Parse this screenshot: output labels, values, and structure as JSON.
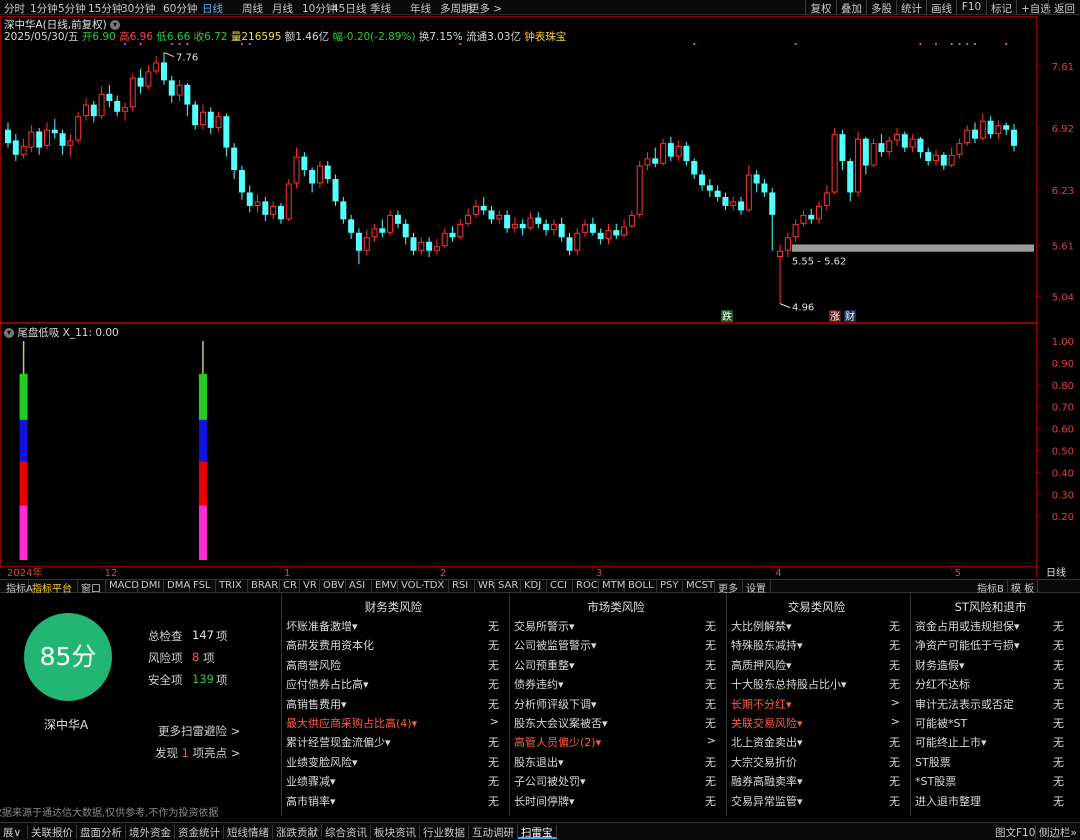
{
  "periods": [
    "分时",
    "1分钟",
    "5分钟",
    "15分钟",
    "30分钟",
    "60分钟",
    "日线",
    "周线",
    "月线",
    "10分钟",
    "45日线",
    "季线",
    "年线",
    "多周期",
    "更多 >"
  ],
  "active_period": "日线",
  "toolbar_right": [
    "复权",
    "叠加",
    "多股",
    "统计",
    "画线",
    "F10",
    "标记",
    "+自选",
    "返回"
  ],
  "stock": {
    "title": "深中华A(日线,前复权)",
    "date": "2025/05/30/五",
    "open": "开6.90",
    "high": "高6.96",
    "low": "低6.66",
    "close": "收6.72",
    "volume": "量216595",
    "amount": "额1.46亿",
    "change": "幅-0.20(-2.89%)",
    "turnover": "换7.15%",
    "float": "流通3.03亿",
    "tag": "钟表珠宝"
  },
  "chart_data": {
    "type": "candlestick",
    "price_ylim": [
      4.8,
      7.9
    ],
    "price_ticks": [
      "7.61",
      "6.92",
      "6.23",
      "5.61",
      "5.04"
    ],
    "price_tick_values": [
      7.61,
      6.92,
      6.23,
      5.61,
      5.04
    ],
    "annotations": {
      "high": "7.76",
      "low": "4.96",
      "range": "5.55 - 5.62"
    },
    "markers": {
      "down": "跌",
      "up": "涨",
      "fin": "财"
    },
    "x_labels": [
      "2024年",
      "12",
      "1",
      "2",
      "3",
      "4",
      "5"
    ],
    "x_label_index": [
      0,
      12,
      35,
      55,
      75,
      98,
      121
    ],
    "indicator_title": "尾盘低吸 X_11: 0.00",
    "indicator_ticks": [
      "1.00",
      "0.90",
      "0.80",
      "0.70",
      "0.60",
      "0.50",
      "0.40",
      "0.30",
      "0.20"
    ],
    "indicator_tick_values": [
      1.0,
      0.9,
      0.8,
      0.7,
      0.6,
      0.5,
      0.4,
      0.3,
      0.2
    ],
    "indicator_bars": [
      {
        "index": 2,
        "value": 1.0,
        "segments": [
          {
            "to": 0.25,
            "color": "#ff2bd6"
          },
          {
            "to": 0.45,
            "color": "#e80000"
          },
          {
            "to": 0.64,
            "color": "#1111e0"
          },
          {
            "to": 0.85,
            "color": "#22cc22"
          },
          {
            "to": 1.0,
            "color": "#c8c878"
          }
        ]
      },
      {
        "index": 25,
        "value": 1.0,
        "segments": [
          {
            "to": 0.25,
            "color": "#ff2bd6"
          },
          {
            "to": 0.45,
            "color": "#e80000"
          },
          {
            "to": 0.64,
            "color": "#1111e0"
          },
          {
            "to": 0.85,
            "color": "#22cc22"
          },
          {
            "to": 1.0,
            "color": "#c8c878"
          }
        ]
      }
    ],
    "candles": [
      [
        6.9,
        6.75,
        6.98,
        6.7
      ],
      [
        6.78,
        6.62,
        6.85,
        6.55
      ],
      [
        6.62,
        6.72,
        6.8,
        6.58
      ],
      [
        6.7,
        6.88,
        6.95,
        6.65
      ],
      [
        6.88,
        6.7,
        6.92,
        6.62
      ],
      [
        6.72,
        6.9,
        6.98,
        6.68
      ],
      [
        6.9,
        6.86,
        7.02,
        6.8
      ],
      [
        6.86,
        6.72,
        6.9,
        6.62
      ],
      [
        6.72,
        6.78,
        6.85,
        6.6
      ],
      [
        6.78,
        7.05,
        7.1,
        6.75
      ],
      [
        7.05,
        7.18,
        7.25,
        7.0
      ],
      [
        7.18,
        7.05,
        7.22,
        6.98
      ],
      [
        7.05,
        7.3,
        7.38,
        7.02
      ],
      [
        7.3,
        7.22,
        7.4,
        7.15
      ],
      [
        7.22,
        7.1,
        7.28,
        7.05
      ],
      [
        7.1,
        7.15,
        7.2,
        7.0
      ],
      [
        7.15,
        7.48,
        7.52,
        7.1
      ],
      [
        7.48,
        7.38,
        7.58,
        7.3
      ],
      [
        7.38,
        7.55,
        7.62,
        7.35
      ],
      [
        7.55,
        7.65,
        7.72,
        7.52
      ],
      [
        7.65,
        7.45,
        7.76,
        7.4
      ],
      [
        7.45,
        7.28,
        7.5,
        7.2
      ],
      [
        7.28,
        7.4,
        7.45,
        7.22
      ],
      [
        7.4,
        7.18,
        7.42,
        7.05
      ],
      [
        7.18,
        6.95,
        7.22,
        6.9
      ],
      [
        6.95,
        7.1,
        7.18,
        6.9
      ],
      [
        7.1,
        6.92,
        7.15,
        6.85
      ],
      [
        6.92,
        7.05,
        7.1,
        6.88
      ],
      [
        7.05,
        6.7,
        7.08,
        6.6
      ],
      [
        6.7,
        6.45,
        6.75,
        6.35
      ],
      [
        6.45,
        6.2,
        6.5,
        6.12
      ],
      [
        6.2,
        6.05,
        6.28,
        5.98
      ],
      [
        6.05,
        6.1,
        6.18,
        5.98
      ],
      [
        6.1,
        5.95,
        6.15,
        5.88
      ],
      [
        5.95,
        6.05,
        6.1,
        5.9
      ],
      [
        6.05,
        5.9,
        6.08,
        5.85
      ],
      [
        5.9,
        6.3,
        6.35,
        5.88
      ],
      [
        6.3,
        6.6,
        6.7,
        6.25
      ],
      [
        6.6,
        6.45,
        6.65,
        6.38
      ],
      [
        6.45,
        6.3,
        6.48,
        6.2
      ],
      [
        6.3,
        6.5,
        6.55,
        6.25
      ],
      [
        6.5,
        6.35,
        6.55,
        6.3
      ],
      [
        6.35,
        6.1,
        6.4,
        6.05
      ],
      [
        6.1,
        5.9,
        6.15,
        5.85
      ],
      [
        5.9,
        5.75,
        5.95,
        5.68
      ],
      [
        5.75,
        5.55,
        5.8,
        5.4
      ],
      [
        5.55,
        5.7,
        5.78,
        5.5
      ],
      [
        5.7,
        5.8,
        5.85,
        5.65
      ],
      [
        5.8,
        5.75,
        5.9,
        5.7
      ],
      [
        5.75,
        5.95,
        6.0,
        5.72
      ],
      [
        5.95,
        5.85,
        6.0,
        5.8
      ],
      [
        5.85,
        5.7,
        5.9,
        5.62
      ],
      [
        5.7,
        5.55,
        5.75,
        5.5
      ],
      [
        5.55,
        5.65,
        5.7,
        5.5
      ],
      [
        5.65,
        5.55,
        5.7,
        5.48
      ],
      [
        5.55,
        5.6,
        5.68,
        5.5
      ],
      [
        5.6,
        5.75,
        5.8,
        5.58
      ],
      [
        5.75,
        5.7,
        5.82,
        5.65
      ],
      [
        5.7,
        5.85,
        5.9,
        5.68
      ],
      [
        5.85,
        5.95,
        6.02,
        5.82
      ],
      [
        5.95,
        6.05,
        6.12,
        5.92
      ],
      [
        6.05,
        6.0,
        6.15,
        5.95
      ],
      [
        6.0,
        5.9,
        6.05,
        5.85
      ],
      [
        5.9,
        5.95,
        6.0,
        5.85
      ],
      [
        5.95,
        5.8,
        6.0,
        5.75
      ],
      [
        5.8,
        5.85,
        5.92,
        5.75
      ],
      [
        5.85,
        5.8,
        5.9,
        5.72
      ],
      [
        5.8,
        5.92,
        5.98,
        5.78
      ],
      [
        5.92,
        5.85,
        5.98,
        5.8
      ],
      [
        5.85,
        5.78,
        5.9,
        5.72
      ],
      [
        5.78,
        5.85,
        5.9,
        5.72
      ],
      [
        5.85,
        5.7,
        5.92,
        5.65
      ],
      [
        5.7,
        5.55,
        5.75,
        5.5
      ],
      [
        5.55,
        5.75,
        5.8,
        5.5
      ],
      [
        5.75,
        5.85,
        5.9,
        5.7
      ],
      [
        5.85,
        5.75,
        5.92,
        5.72
      ],
      [
        5.75,
        5.68,
        5.8,
        5.62
      ],
      [
        5.68,
        5.78,
        5.85,
        5.62
      ],
      [
        5.78,
        5.72,
        5.85,
        5.68
      ],
      [
        5.72,
        5.82,
        5.9,
        5.7
      ],
      [
        5.82,
        5.95,
        6.0,
        5.8
      ],
      [
        5.95,
        6.5,
        6.55,
        5.92
      ],
      [
        6.5,
        6.58,
        6.65,
        6.45
      ],
      [
        6.58,
        6.52,
        6.7,
        6.48
      ],
      [
        6.52,
        6.75,
        6.8,
        6.5
      ],
      [
        6.75,
        6.6,
        6.82,
        6.55
      ],
      [
        6.6,
        6.72,
        6.78,
        6.55
      ],
      [
        6.72,
        6.55,
        6.76,
        6.5
      ],
      [
        6.55,
        6.4,
        6.58,
        6.35
      ],
      [
        6.4,
        6.28,
        6.45,
        6.22
      ],
      [
        6.28,
        6.22,
        6.35,
        6.15
      ],
      [
        6.22,
        6.15,
        6.28,
        6.1
      ],
      [
        6.15,
        6.05,
        6.2,
        6.0
      ],
      [
        6.05,
        6.1,
        6.15,
        6.0
      ],
      [
        6.1,
        6.0,
        6.15,
        5.95
      ],
      [
        6.0,
        6.4,
        6.5,
        5.98
      ],
      [
        6.4,
        6.3,
        6.45,
        6.2
      ],
      [
        6.3,
        6.2,
        6.35,
        6.15
      ],
      [
        6.2,
        5.95,
        6.25,
        5.55
      ],
      [
        5.48,
        5.55,
        5.62,
        4.96
      ],
      [
        5.55,
        5.7,
        5.75,
        5.48
      ],
      [
        5.7,
        5.85,
        5.9,
        5.65
      ],
      [
        5.85,
        5.95,
        6.0,
        5.82
      ],
      [
        5.95,
        5.9,
        6.02,
        5.85
      ],
      [
        5.9,
        6.05,
        6.1,
        5.85
      ],
      [
        6.05,
        6.2,
        6.28,
        6.0
      ],
      [
        6.2,
        6.85,
        6.92,
        6.18
      ],
      [
        6.85,
        6.55,
        6.9,
        6.45
      ],
      [
        6.55,
        6.2,
        6.58,
        6.1
      ],
      [
        6.2,
        6.8,
        6.88,
        6.15
      ],
      [
        6.8,
        6.5,
        6.82,
        6.4
      ],
      [
        6.5,
        6.75,
        6.8,
        6.48
      ],
      [
        6.75,
        6.65,
        6.85,
        6.6
      ],
      [
        6.65,
        6.78,
        6.82,
        6.6
      ],
      [
        6.78,
        6.85,
        6.92,
        6.72
      ],
      [
        6.85,
        6.7,
        6.88,
        6.65
      ],
      [
        6.7,
        6.8,
        6.85,
        6.65
      ],
      [
        6.8,
        6.65,
        6.82,
        6.58
      ],
      [
        6.65,
        6.55,
        6.7,
        6.5
      ],
      [
        6.55,
        6.62,
        6.68,
        6.5
      ],
      [
        6.62,
        6.5,
        6.65,
        6.45
      ],
      [
        6.5,
        6.62,
        6.7,
        6.48
      ],
      [
        6.62,
        6.75,
        6.8,
        6.58
      ],
      [
        6.75,
        6.9,
        6.95,
        6.72
      ],
      [
        6.9,
        6.8,
        6.98,
        6.75
      ],
      [
        6.8,
        7.0,
        7.08,
        6.78
      ],
      [
        7.0,
        6.85,
        7.05,
        6.8
      ],
      [
        6.85,
        6.95,
        7.0,
        6.8
      ],
      [
        6.95,
        6.9,
        6.98,
        6.84
      ],
      [
        6.9,
        6.72,
        6.96,
        6.66
      ]
    ]
  },
  "indicator_tabs": [
    "指标A",
    "指标平台",
    "窗口",
    "MACD",
    "DMI",
    "DMA",
    "FSL",
    "TRIX",
    "BRAR",
    "CR",
    "VR",
    "OBV",
    "ASI",
    "EMV",
    "VOL-TDX",
    "RSI",
    "WR",
    "SAR",
    "KDJ",
    "CCI",
    "ROC",
    "MTM",
    "BOLL",
    "PSY",
    "MCST",
    "更多",
    "设置"
  ],
  "indicator_tabs_right": [
    "指标B",
    "模 板"
  ],
  "risk": {
    "score": "85分",
    "stock_name": "深中华A",
    "total_label": "总检查",
    "total_value": "147",
    "total_unit": "项",
    "risk_label": "风险项",
    "risk_value": "8",
    "risk_unit": "项",
    "safe_label": "安全项",
    "safe_value": "139",
    "safe_unit": "项",
    "more_link": "更多扫雷避险 >",
    "found_prefix": "发现",
    "found_value": "1",
    "found_suffix": "项亮点 >",
    "disclaimer": "数据来源于通达信大数据,仅供参考,不作为投资依据",
    "columns": [
      {
        "title": "财务类风险",
        "items": [
          {
            "label": "坏账准备激增▾",
            "value": "无"
          },
          {
            "label": "高研发费用资本化",
            "value": "无"
          },
          {
            "label": "高商誉风险",
            "value": "无"
          },
          {
            "label": "应付债券占比高▾",
            "value": "无"
          },
          {
            "label": "高销售费用▾",
            "value": "无"
          },
          {
            "label": "最大供应商采购占比高(4)▾",
            "value": ">",
            "red": true
          },
          {
            "label": "累计经营现金流偏少▾",
            "value": "无"
          },
          {
            "label": "业绩变脸风险▾",
            "value": "无"
          },
          {
            "label": "业绩骤减▾",
            "value": "无"
          },
          {
            "label": "高市销率▾",
            "value": "无"
          }
        ]
      },
      {
        "title": "市场类风险",
        "items": [
          {
            "label": "交易所警示▾",
            "value": "无"
          },
          {
            "label": "公司被监管警示▾",
            "value": "无"
          },
          {
            "label": "公司预重整▾",
            "value": "无"
          },
          {
            "label": "债券违约▾",
            "value": "无"
          },
          {
            "label": "分析师评级下调▾",
            "value": "无"
          },
          {
            "label": "股东大会议案被否▾",
            "value": "无"
          },
          {
            "label": "高管人员偏少(2)▾",
            "value": ">",
            "red": true
          },
          {
            "label": "股东退出▾",
            "value": "无"
          },
          {
            "label": "子公司被处罚▾",
            "value": "无"
          },
          {
            "label": "长时间停牌▾",
            "value": "无"
          }
        ]
      },
      {
        "title": "交易类风险",
        "items": [
          {
            "label": "大比例解禁▾",
            "value": "无"
          },
          {
            "label": "特殊股东减持▾",
            "value": "无"
          },
          {
            "label": "高质押风险▾",
            "value": "无"
          },
          {
            "label": "十大股东总持股占比小▾",
            "value": "无"
          },
          {
            "label": "长期不分红▾",
            "value": ">",
            "red": true
          },
          {
            "label": "关联交易风险▾",
            "value": ">",
            "red": true
          },
          {
            "label": "北上资金卖出▾",
            "value": "无"
          },
          {
            "label": "大宗交易折价",
            "value": "无"
          },
          {
            "label": "融券高融卖率▾",
            "value": "无"
          },
          {
            "label": "交易异常监管▾",
            "value": "无"
          }
        ]
      },
      {
        "title": "ST风险和退市",
        "items": [
          {
            "label": "资金占用或违规担保▾",
            "value": "无"
          },
          {
            "label": "净资产可能低于亏损▾",
            "value": "无"
          },
          {
            "label": "财务造假▾",
            "value": "无"
          },
          {
            "label": "分红不达标",
            "value": "无"
          },
          {
            "label": "审计无法表示或否定",
            "value": "无"
          },
          {
            "label": "可能被*ST",
            "value": "无"
          },
          {
            "label": "可能终止上市▾",
            "value": "无"
          },
          {
            "label": "ST股票",
            "value": "无"
          },
          {
            "label": "*ST股票",
            "value": "无"
          },
          {
            "label": "进入退市整理",
            "value": "无"
          }
        ]
      }
    ]
  },
  "bottom_tabs": [
    "展∨",
    "关联报价",
    "盘面分析",
    "境外资金",
    "资金统计",
    "短线情绪",
    "涨跌贡献",
    "综合资讯",
    "板块资讯",
    "行业数据",
    "互动调研",
    "扫雷宝"
  ],
  "active_bottom_tab": "扫雷宝",
  "bottom_right": [
    "图文F10",
    "侧边栏»"
  ],
  "day_label": "日线"
}
